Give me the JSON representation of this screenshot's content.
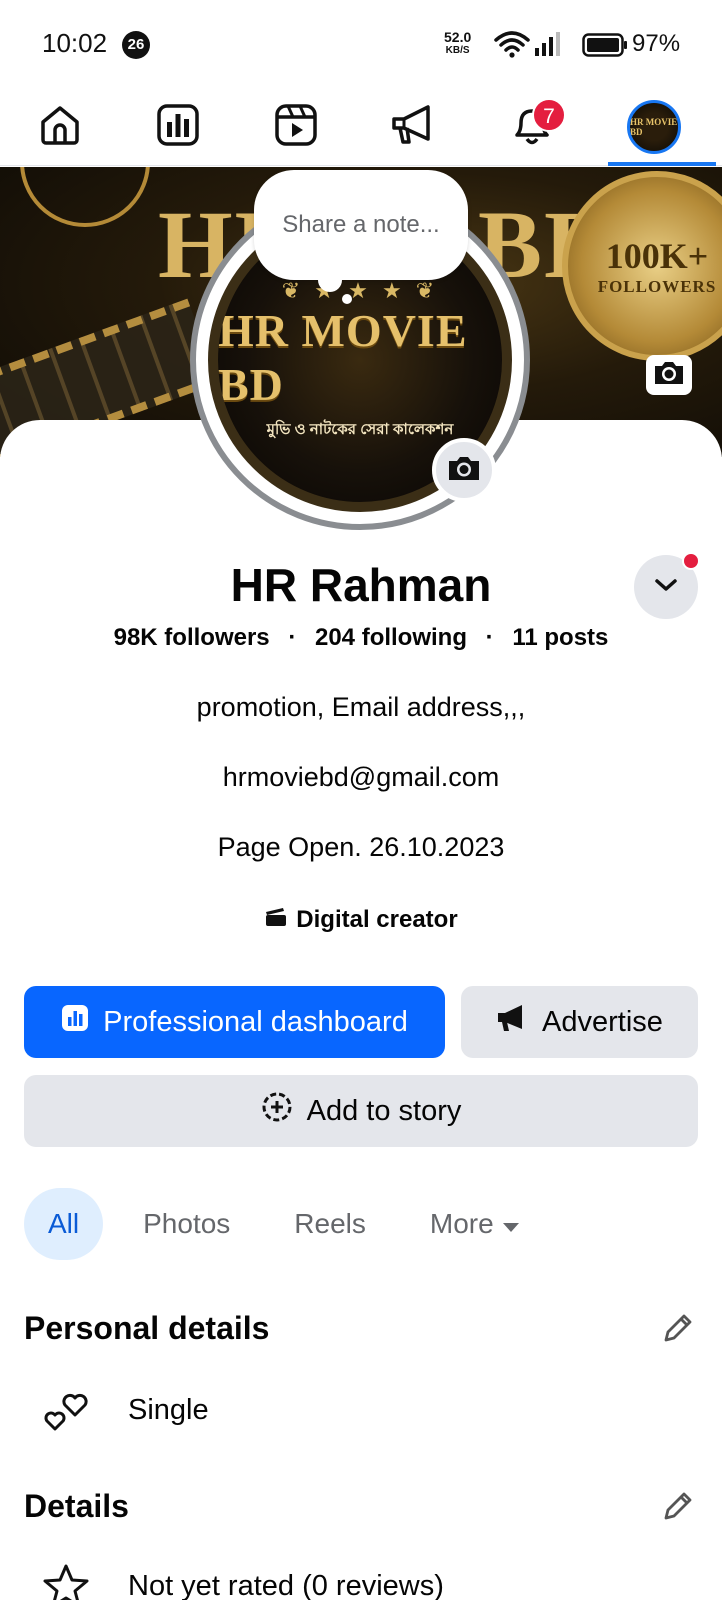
{
  "status_bar": {
    "time": "10:02",
    "notification_count": "26",
    "speed_value": "52.0",
    "speed_unit": "KB/S",
    "battery_pct": "97%"
  },
  "nav": {
    "items": [
      "home-icon",
      "dashboard-icon",
      "reels-icon",
      "megaphone-icon",
      "bell-icon",
      "profile-avatar"
    ],
    "notification_badge": "7",
    "avatar_text": "HR MOVIE BD"
  },
  "cover": {
    "title": "HR",
    "title2": "BD",
    "medal_top": "100K+",
    "medal_bottom": "FOLLOWERS"
  },
  "note": {
    "placeholder": "Share a note..."
  },
  "profile_picture": {
    "logo": "HR MOVIE BD",
    "tagline": "মুভি ও নাটকের সেরা কালেকশন",
    "ornament": "❦ ★ ★ ★ ❦"
  },
  "profile": {
    "name": "HR Rahman",
    "followers": "98K followers",
    "following": "204 following",
    "posts": "11 posts",
    "separator": "·",
    "bio_lines": [
      "promotion, Email address,,,",
      "hrmoviebd@gmail.com",
      "Page Open. 26.10.2023"
    ],
    "category": "Digital creator"
  },
  "buttons": {
    "dashboard": "Professional dashboard",
    "advertise": "Advertise",
    "add_story": "Add to story"
  },
  "tabs": [
    "All",
    "Photos",
    "Reels",
    "More"
  ],
  "personal_details": {
    "title": "Personal details",
    "relationship": "Single"
  },
  "details": {
    "title": "Details",
    "rating": "Not yet rated (0 reviews)"
  },
  "colors": {
    "primary": "#0866ff",
    "badge": "#e41e3f",
    "secondary_bg": "#e4e6eb",
    "active_tab_bg": "#dfeefe"
  }
}
